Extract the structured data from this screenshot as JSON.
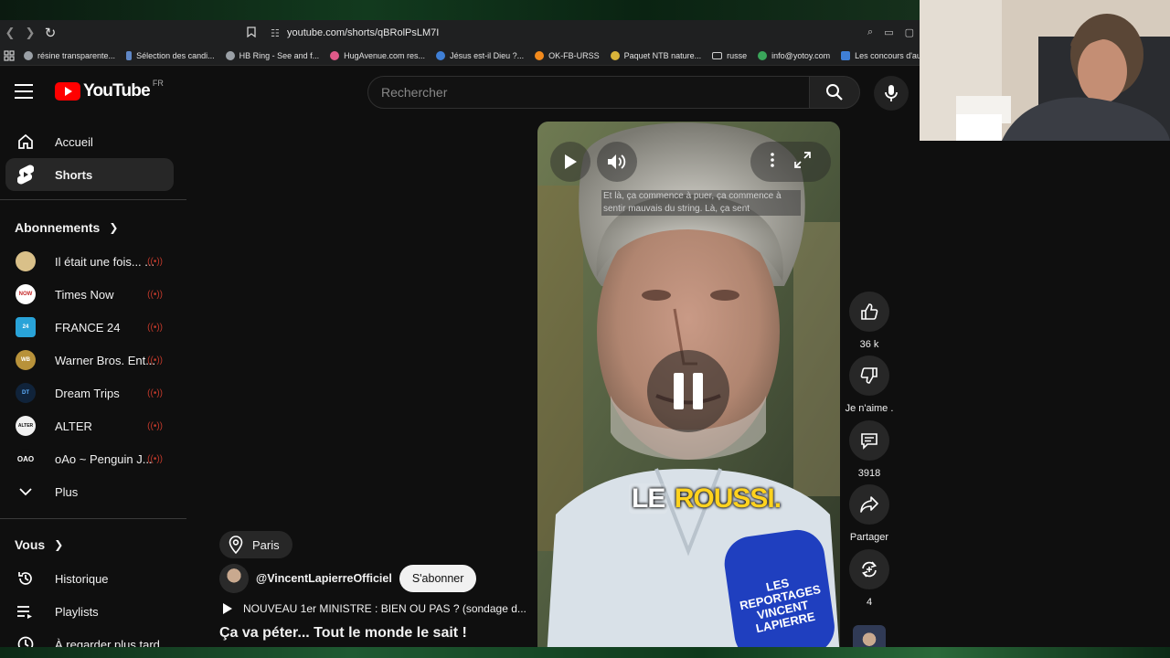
{
  "browser": {
    "url": "youtube.com/shorts/qBRolPsLM7I",
    "bookmarks": [
      {
        "label": "résine transparente...",
        "color": "#9aa0a6"
      },
      {
        "label": "Sélection des candi...",
        "color": "#5f87c6"
      },
      {
        "label": "HB Ring - See and f...",
        "color": "#9aa0a6"
      },
      {
        "label": "HugAvenue.com res...",
        "color": "#e05a8a"
      },
      {
        "label": "Jésus est-il Dieu ?...",
        "color": "#3f7fd6"
      },
      {
        "label": "OK-FB-URSS",
        "color": "#f28a1c"
      },
      {
        "label": "Paquet NTB nature...",
        "color": "#d9b43a"
      },
      {
        "label": "russe",
        "color": "#9aa0a6"
      },
      {
        "label": "info@yotoy.com",
        "color": "#3aa55a"
      },
      {
        "label": "Les concours d'au...",
        "color": "#3f7fd6"
      }
    ]
  },
  "header": {
    "logo_text": "YouTube",
    "country": "FR",
    "search_placeholder": "Rechercher"
  },
  "sidebar": {
    "home": "Accueil",
    "shorts": "Shorts",
    "subscriptions_title": "Abonnements",
    "subscriptions": [
      {
        "label": "Il était une fois... ...",
        "avatar_color": "#d9c089",
        "avatar_text": ""
      },
      {
        "label": "Times Now",
        "avatar_color": "#c62828",
        "avatar_text": "NOW"
      },
      {
        "label": "FRANCE 24",
        "avatar_color": "#29a3d8",
        "avatar_text": "24"
      },
      {
        "label": "Warner Bros. Ent...",
        "avatar_color": "#b8923a",
        "avatar_text": "WB"
      },
      {
        "label": "Dream Trips",
        "avatar_color": "#10233a",
        "avatar_text": "DT"
      },
      {
        "label": "ALTER",
        "avatar_color": "#f1f1f1",
        "avatar_text": "ALTER"
      },
      {
        "label": "oAo ~ Penguin J...",
        "avatar_color": "#0f0f0f",
        "avatar_text": "OAO"
      }
    ],
    "more": "Plus",
    "you_title": "Vous",
    "history": "Historique",
    "playlists": "Playlists",
    "watch_later": "À regarder plus tard"
  },
  "video": {
    "caption": "Et là, ça commence à puer, ça commence à sentir mauvais du string. Là, ça sent",
    "subtitle_white": "LE",
    "subtitle_yellow": "ROUSSI.",
    "mic_text": "LES REPORTAGES VINCENT LAPIERRE"
  },
  "actions": {
    "likes": "36 k",
    "dislike": "Je n'aime .",
    "comments": "3918",
    "share": "Partager",
    "remix": "4"
  },
  "info": {
    "location": "Paris",
    "channel": "@VincentLapierreOfficiel",
    "subscribe": "S'abonner",
    "playlist": "NOUVEAU 1er MINISTRE : BIEN OU PAS ? (sondage d...",
    "title": "Ça va péter... Tout le monde le sait !"
  }
}
